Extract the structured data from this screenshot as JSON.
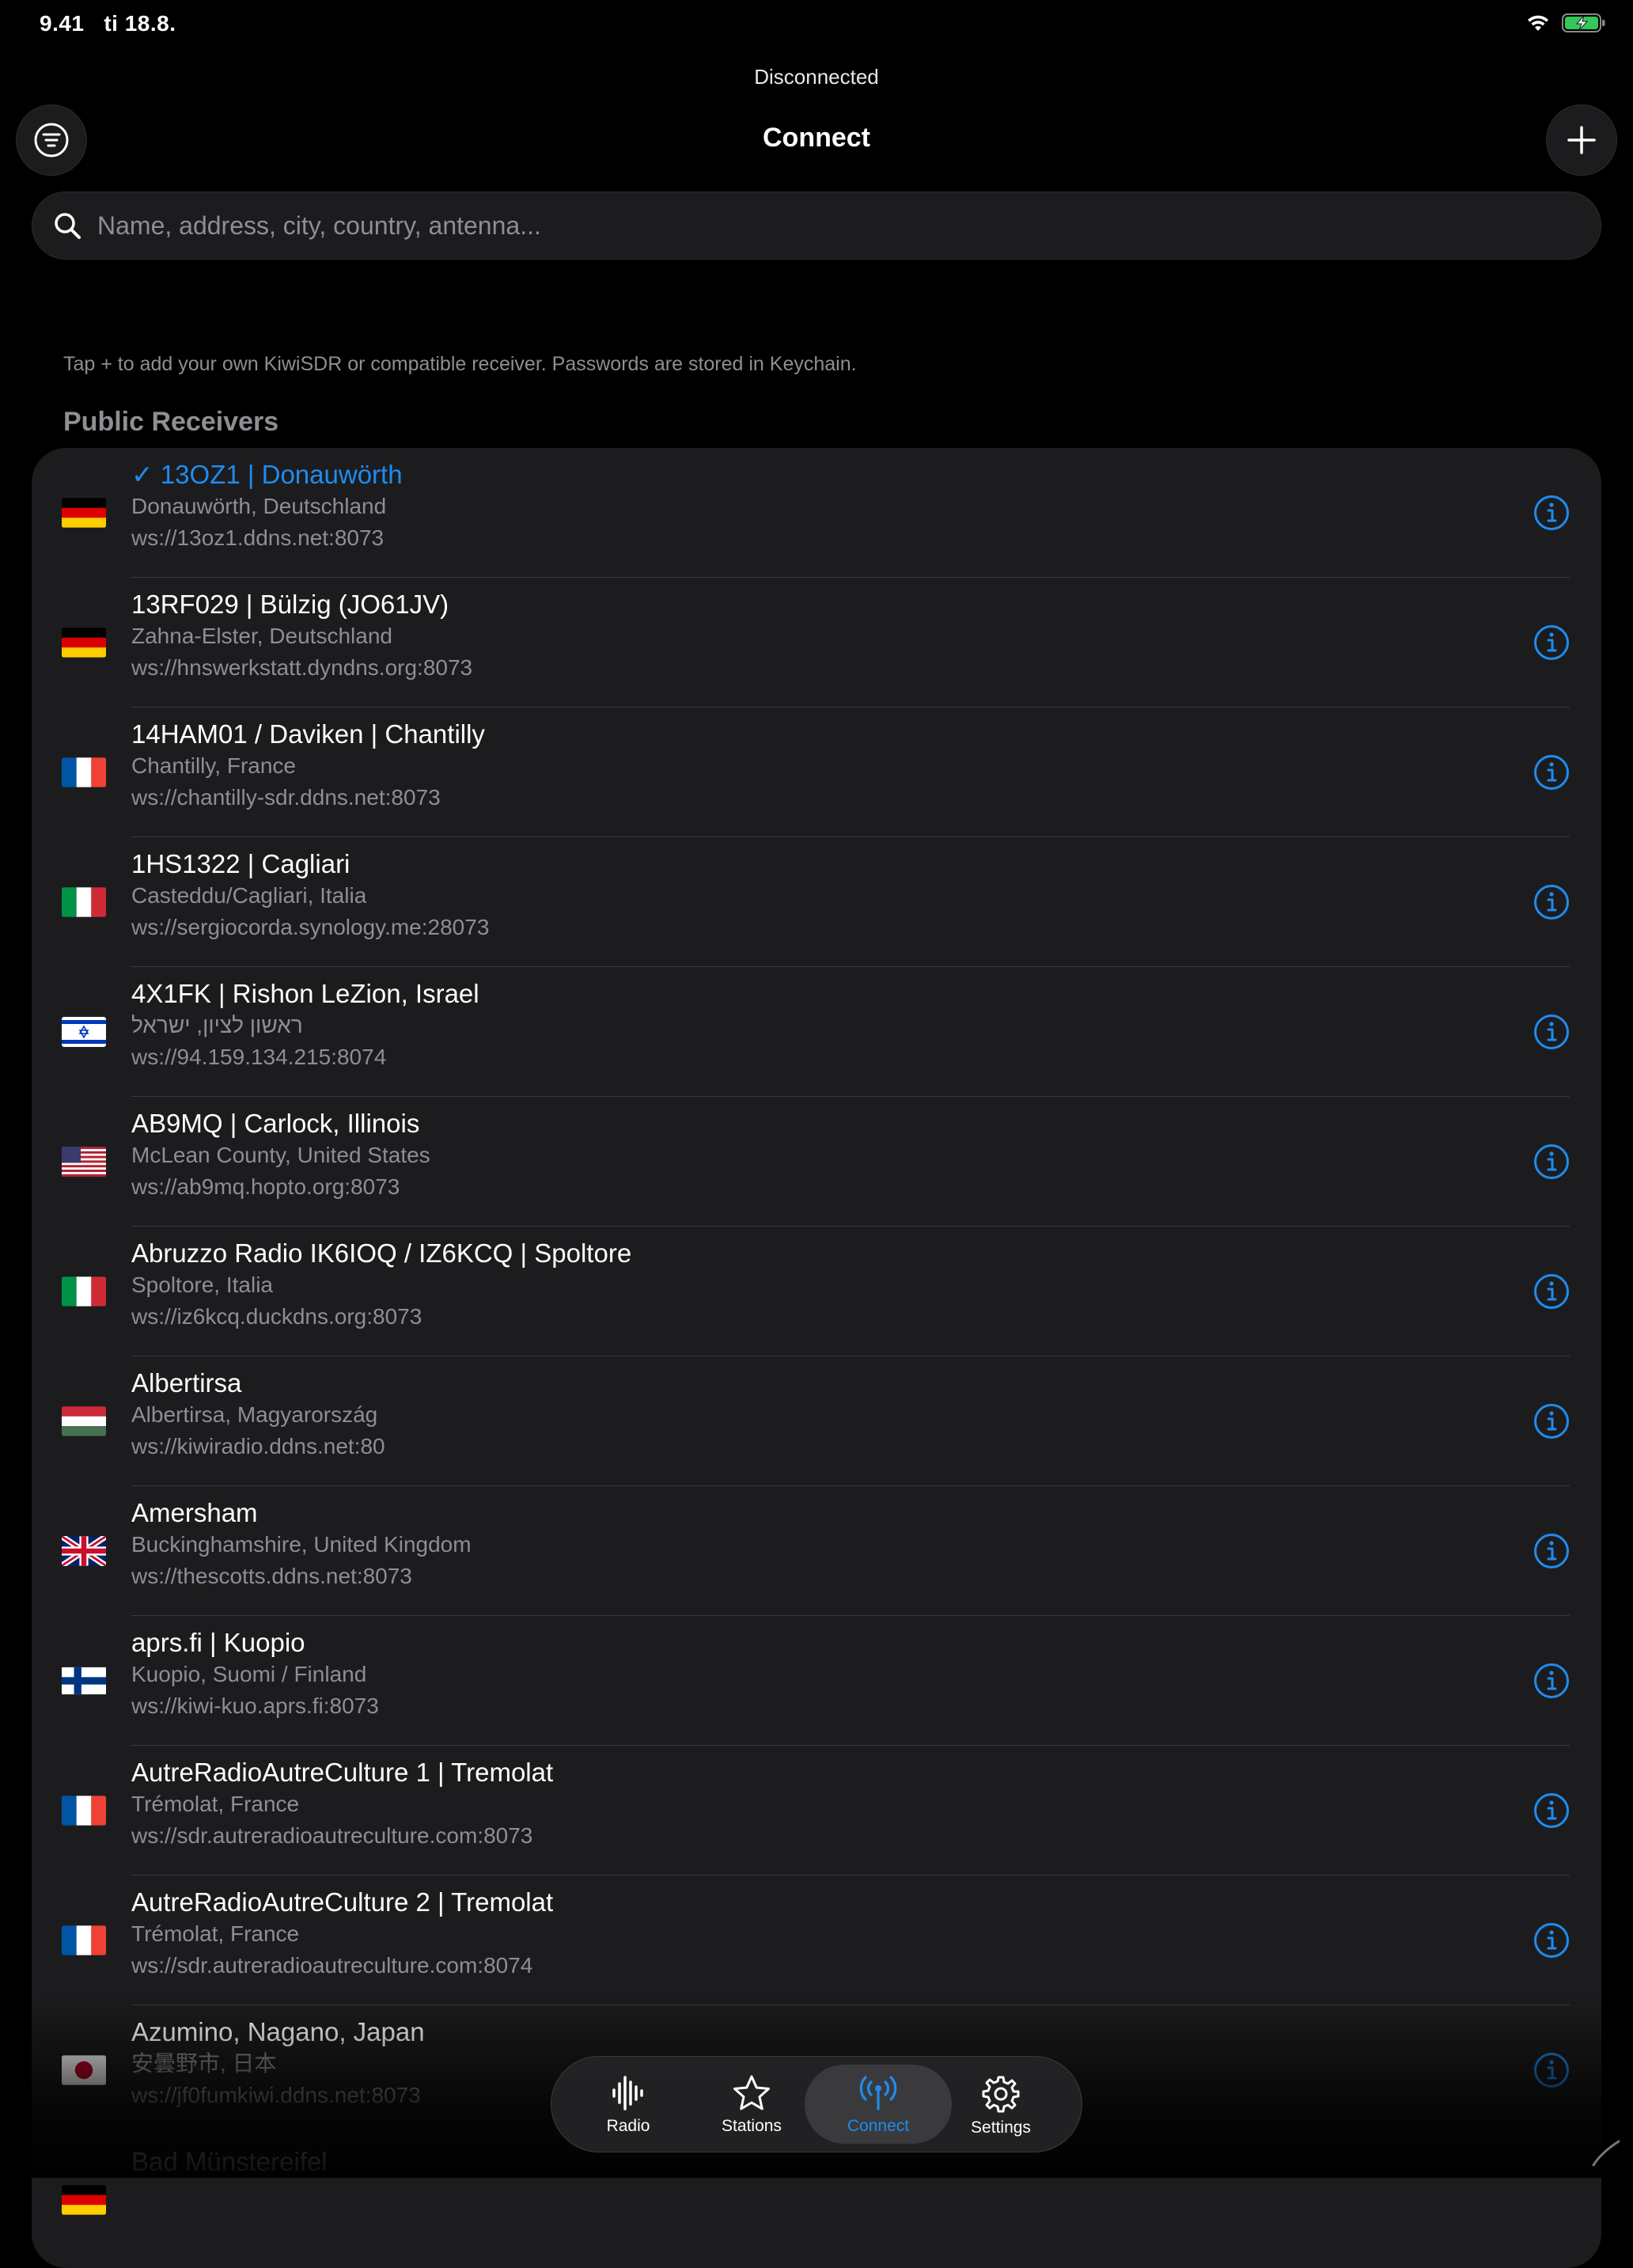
{
  "status_bar": {
    "time": "9.41",
    "date": "ti 18.8."
  },
  "connection_status": "Disconnected",
  "header": {
    "title": "Connect"
  },
  "search": {
    "placeholder": "Name, address, city, country, antenna..."
  },
  "hint": "Tap + to add your own KiwiSDR or compatible receiver. Passwords are stored in Keychain.",
  "section_title": "Public Receivers",
  "receivers": [
    {
      "name": "13OZ1 | Donauwörth",
      "selected": true,
      "location": "Donauwörth, Deutschland",
      "url": "ws://13oz1.ddns.net:8073",
      "flag": "DE"
    },
    {
      "name": "13RF029 | Bülzig (JO61JV)",
      "location": "Zahna-Elster, Deutschland",
      "url": "ws://hnswerkstatt.dyndns.org:8073",
      "flag": "DE"
    },
    {
      "name": "14HAM01 / Daviken | Chantilly",
      "location": "Chantilly, France",
      "url": "ws://chantilly-sdr.ddns.net:8073",
      "flag": "FR"
    },
    {
      "name": "1HS1322 | Cagliari",
      "location": "Casteddu/Cagliari, Italia",
      "url": "ws://sergiocorda.synology.me:28073",
      "flag": "IT"
    },
    {
      "name": "4X1FK | Rishon LeZion, Israel",
      "location": "ראשון לציון, ישראל",
      "url": "ws://94.159.134.215:8074",
      "flag": "IL"
    },
    {
      "name": "AB9MQ | Carlock, Illinois",
      "location": "McLean County, United States",
      "url": "ws://ab9mq.hopto.org:8073",
      "flag": "US"
    },
    {
      "name": "Abruzzo Radio IK6IOQ / IZ6KCQ | Spoltore",
      "location": "Spoltore, Italia",
      "url": "ws://iz6kcq.duckdns.org:8073",
      "flag": "IT"
    },
    {
      "name": "Albertirsa",
      "location": "Albertirsa, Magyarország",
      "url": "ws://kiwiradio.ddns.net:80",
      "flag": "HU"
    },
    {
      "name": "Amersham",
      "location": "Buckinghamshire, United Kingdom",
      "url": "ws://thescotts.ddns.net:8073",
      "flag": "GB"
    },
    {
      "name": "aprs.fi | Kuopio",
      "location": "Kuopio, Suomi / Finland",
      "url": "ws://kiwi-kuo.aprs.fi:8073",
      "flag": "FI"
    },
    {
      "name": "AutreRadioAutreCulture 1 | Tremolat",
      "location": "Trémolat, France",
      "url": "ws://sdr.autreradioautreculture.com:8073",
      "flag": "FR"
    },
    {
      "name": "AutreRadioAutreCulture 2 | Tremolat",
      "location": "Trémolat, France",
      "url": "ws://sdr.autreradioautreculture.com:8074",
      "flag": "FR"
    },
    {
      "name": "Azumino, Nagano, Japan",
      "location": "安曇野市, 日本",
      "url": "ws://jf0fumkiwi.ddns.net:8073",
      "flag": "JP"
    },
    {
      "name": "Bad Münstereifel",
      "location": "",
      "url": "",
      "flag": "DE"
    }
  ],
  "tabs": [
    {
      "label": "Radio",
      "icon": "waveform-icon"
    },
    {
      "label": "Stations",
      "icon": "star-icon"
    },
    {
      "label": "Connect",
      "icon": "antenna-icon",
      "active": true
    },
    {
      "label": "Settings",
      "icon": "gear-icon"
    }
  ],
  "colors": {
    "accent": "#1e8cf0",
    "background": "#000000",
    "card": "#1c1c1e",
    "secondary_text": "#8e8e93"
  }
}
